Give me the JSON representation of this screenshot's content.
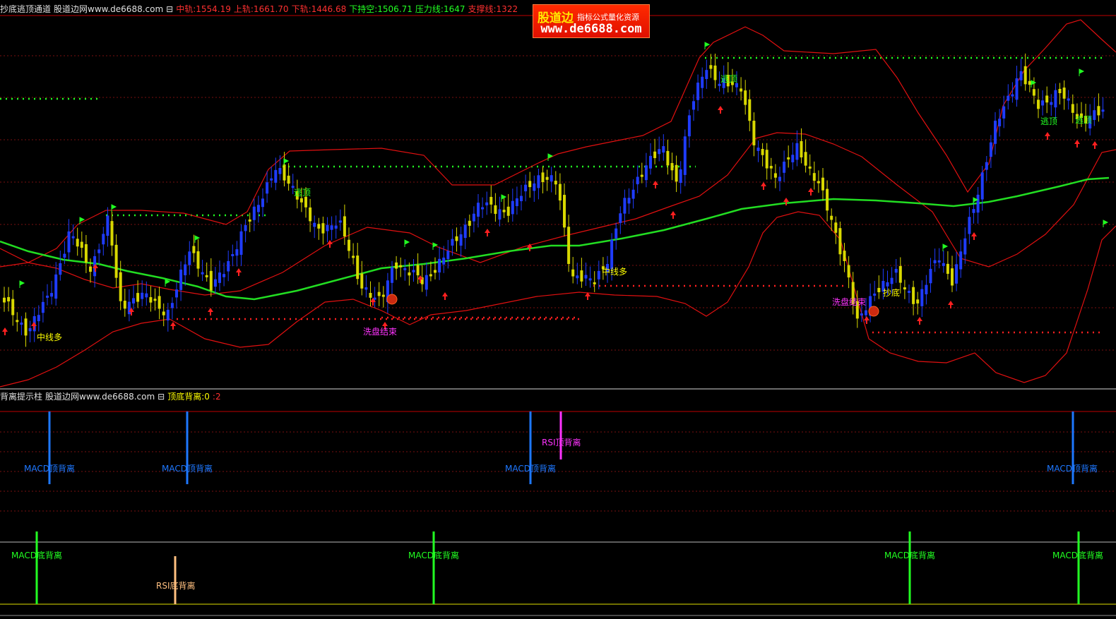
{
  "top_header": {
    "title": "抄底逃顶通道",
    "site": "股道边网www.de6688.com",
    "icon": "grid-icon",
    "readouts": [
      {
        "label": "中轨:",
        "value": "1554.19",
        "color": "#ff3030"
      },
      {
        "label": "上轨:",
        "value": "1661.70",
        "color": "#ff3030"
      },
      {
        "label": "下轨:",
        "value": "1446.68",
        "color": "#ff3030"
      },
      {
        "label": "下持空:",
        "value": "1506.71",
        "color": "#22ff22"
      },
      {
        "label": "压力线:",
        "value": "1647",
        "color": "#22ff22"
      },
      {
        "label": "支撑线:",
        "value": "1322",
        "color": "#ff3030"
      }
    ]
  },
  "logo": {
    "brand": "股道边",
    "tagline": "指标公式量化资源",
    "url": "www.de6688.com"
  },
  "main_chart": {
    "labels": [
      {
        "text": "中线多",
        "color": "#ffff00"
      },
      {
        "text": "逃顶",
        "color": "#22ff22"
      },
      {
        "text": "洗盘结束",
        "color": "#ff33ff"
      },
      {
        "text": "中线多",
        "color": "#ffff00"
      },
      {
        "text": "逃顶",
        "color": "#22ff22"
      },
      {
        "text": "洗盘结束",
        "color": "#ff33ff"
      },
      {
        "text": "抄底",
        "color": "#ffff00"
      },
      {
        "text": "逃顶",
        "color": "#22ff22"
      },
      {
        "text": "逃顶",
        "color": "#22ff22"
      }
    ]
  },
  "sub_header": {
    "title": "背离提示柱",
    "site": "股道边网www.de6688.com",
    "icon": "grid-icon",
    "readout_label": "顶底背离:0",
    "readout_extra": ":2"
  },
  "sub_chart": {
    "top_labels": [
      {
        "text": "MACD顶背离",
        "color": "#1e78ff"
      },
      {
        "text": "MACD顶背离",
        "color": "#1e78ff"
      },
      {
        "text": "RSI顶背离",
        "color": "#ff33ff"
      },
      {
        "text": "MACD顶背离",
        "color": "#1e78ff"
      },
      {
        "text": "MACD顶背离",
        "color": "#1e78ff"
      }
    ],
    "bottom_labels": [
      {
        "text": "MACD底背离",
        "color": "#22ff22"
      },
      {
        "text": "RSI底背离",
        "color": "#ffc080"
      },
      {
        "text": "MACD底背离",
        "color": "#22ff22"
      },
      {
        "text": "MACD底背离",
        "color": "#22ff22"
      },
      {
        "text": "MACD底背离",
        "color": "#22ff22"
      }
    ]
  },
  "colors": {
    "background": "#000000",
    "grid": "#7a1010",
    "band": "#e01010",
    "midline": "#22dd22",
    "candle_up": "#1f3cff",
    "candle_down": "#d8d800",
    "signal_up": "#ff2020",
    "signal_flag": "#22ff22"
  }
}
